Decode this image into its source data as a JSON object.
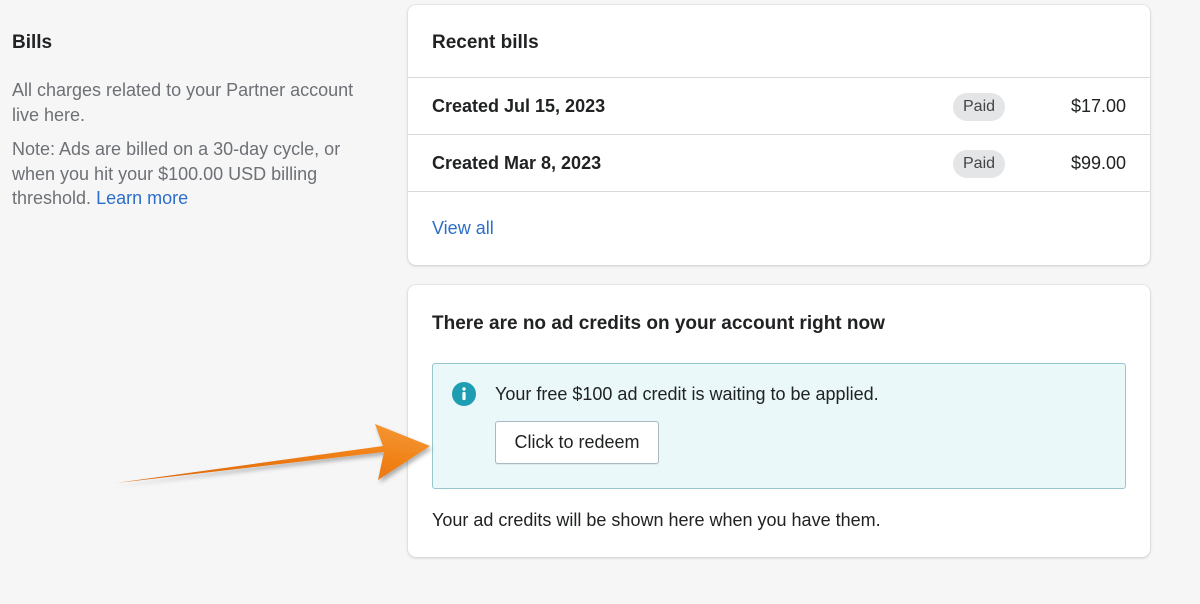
{
  "left": {
    "heading": "Bills",
    "description": "All charges related to your Partner account live here.",
    "note_prefix": "Note: Ads are billed on a 30-day cycle, or when you hit your $100.00 USD billing threshold.",
    "learn_more_label": "Learn more"
  },
  "recent_bills": {
    "title": "Recent bills",
    "rows": [
      {
        "date": "Created Jul 15, 2023",
        "status": "Paid",
        "amount": "$17.00"
      },
      {
        "date": "Created Mar 8, 2023",
        "status": "Paid",
        "amount": "$99.00"
      }
    ],
    "view_all_label": "View all"
  },
  "ad_credits": {
    "title": "There are no ad credits on your account right now",
    "banner_text": "Your free $100 ad credit is waiting to be applied.",
    "redeem_button_label": "Click to redeem",
    "footer_text": "Your ad credits will be shown here when you have them."
  },
  "icons": {
    "info": "info-icon",
    "annotation": "annotation-arrow"
  },
  "colors": {
    "link": "#2c6ecb",
    "info_icon": "#1f9db2",
    "banner_bg": "#eaf8f9",
    "arrow": "#e8720c"
  }
}
